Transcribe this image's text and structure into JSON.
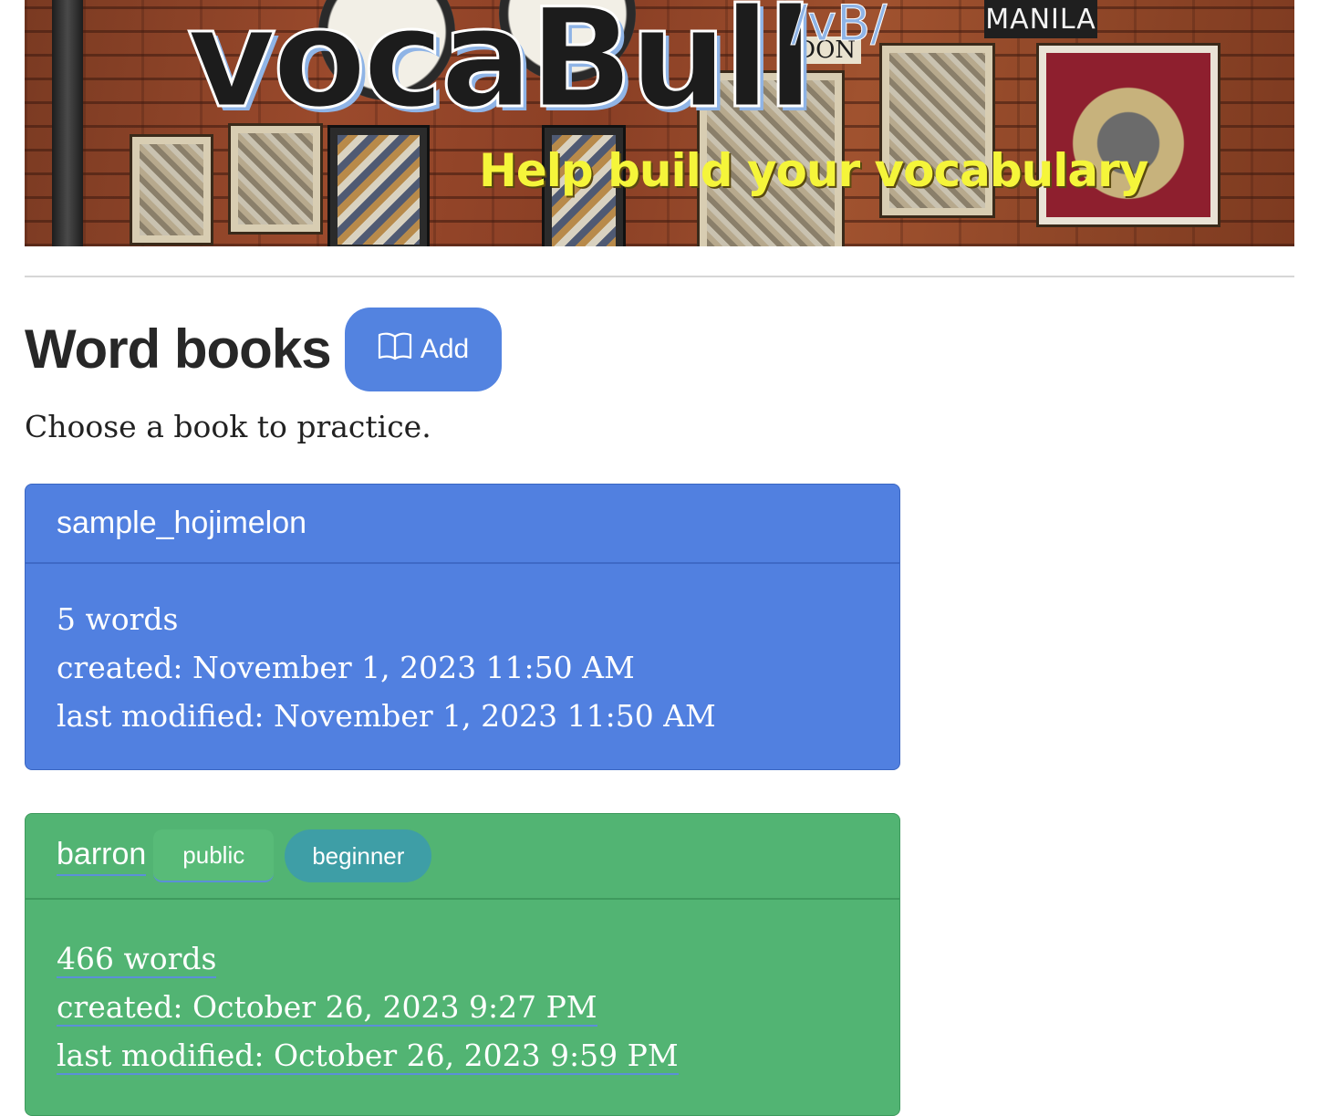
{
  "banner": {
    "logo_text": "vocaBull",
    "logo_phonetic": "/vB/",
    "tagline": "Help build your vocabulary",
    "sign_text": "MANILA",
    "sign2_text": "IDON"
  },
  "header": {
    "title": "Word books",
    "add_button_label": "Add",
    "subtitle": "Choose a book to practice."
  },
  "books": [
    {
      "name": "sample_hojimelon",
      "word_count": "5 words",
      "created": "created: November 1, 2023 11:50 AM",
      "last_modified": "last modified: November 1, 2023 11:50 AM",
      "color": "#5180e0"
    },
    {
      "name": "barron",
      "visibility": "public",
      "level": "beginner",
      "word_count": "466 words",
      "created": "created: October 26, 2023 9:27 PM",
      "last_modified": "last modified: October 26, 2023 9:59 PM",
      "color": "#52b473"
    }
  ],
  "icons": {
    "add_button_icon": "open-book-icon"
  },
  "colors": {
    "primary": "#5383e0",
    "success": "#52b473",
    "info": "#3e9ea6",
    "tagline": "#f5f53a"
  }
}
